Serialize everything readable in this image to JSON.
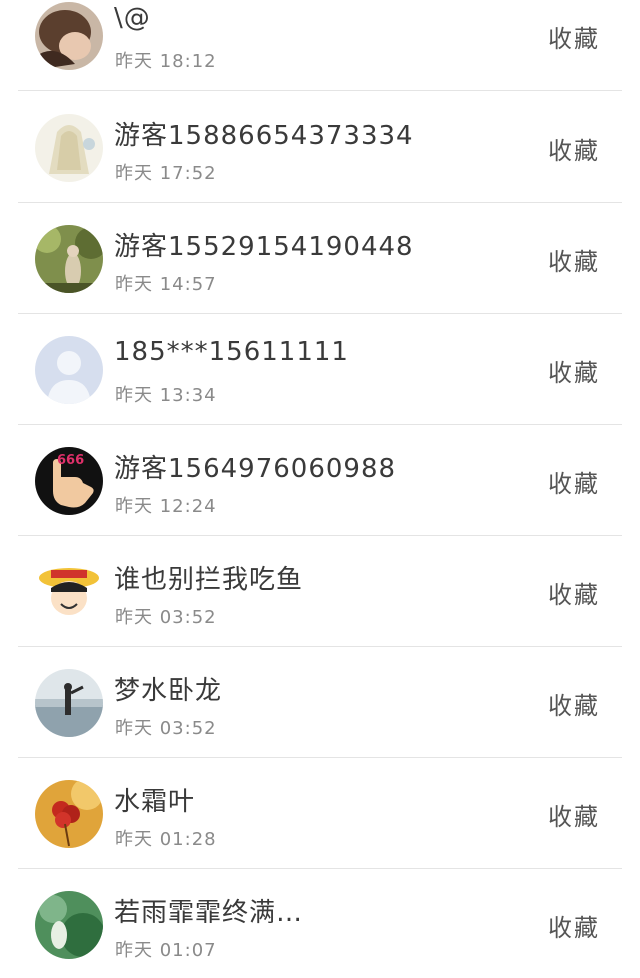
{
  "items": [
    {
      "name": "\\@",
      "time": "昨天 18:12",
      "action": "收藏",
      "avatar_icon": "user-photo-hair-icon"
    },
    {
      "name": "游客15886654373334",
      "time": "昨天 17:52",
      "action": "收藏",
      "avatar_icon": "user-photo-dress-icon"
    },
    {
      "name": "游客15529154190448",
      "time": "昨天 14:57",
      "action": "收藏",
      "avatar_icon": "user-photo-forest-icon"
    },
    {
      "name": "185***15611111",
      "time": "昨天 13:34",
      "action": "收藏",
      "avatar_icon": "default-avatar-icon"
    },
    {
      "name": "游客1564976060988",
      "time": "昨天 12:24",
      "action": "收藏",
      "avatar_icon": "hand-666-icon"
    },
    {
      "name": "谁也别拦我吃鱼",
      "time": "昨天 03:52",
      "action": "收藏",
      "avatar_icon": "cartoon-straw-hat-icon"
    },
    {
      "name": "梦水卧龙",
      "time": "昨天 03:52",
      "action": "收藏",
      "avatar_icon": "person-beach-icon"
    },
    {
      "name": "水霜叶",
      "time": "昨天 01:28",
      "action": "收藏",
      "avatar_icon": "red-flower-icon"
    },
    {
      "name": "若雨霏霏终满…",
      "time": "昨天 01:07",
      "action": "收藏",
      "avatar_icon": "green-lotus-icon"
    }
  ]
}
